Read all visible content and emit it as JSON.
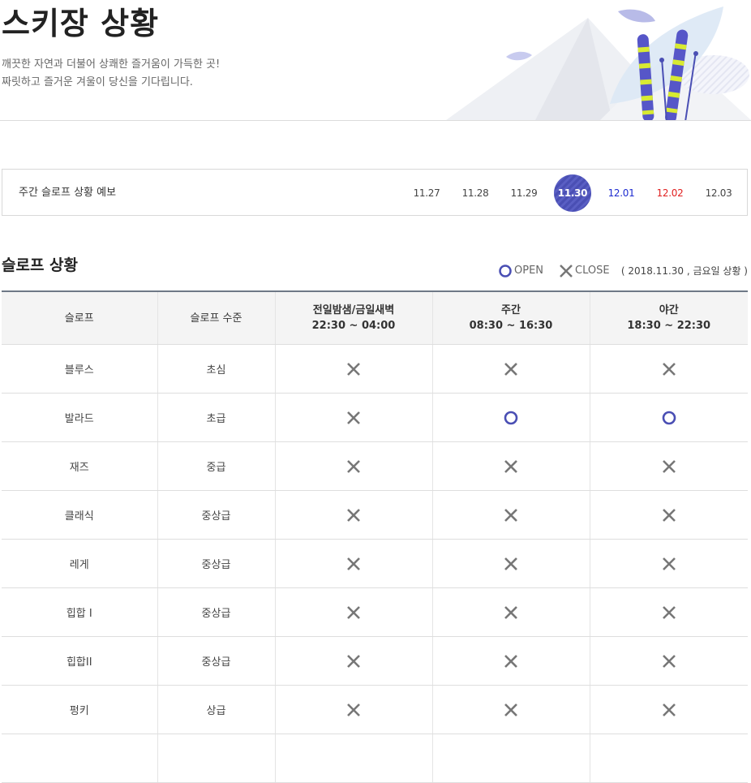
{
  "header": {
    "title": "스키장 상황",
    "subtitle_line1": "깨끗한 자연과 더불어 상쾌한 즐거움이 가득한 곳!",
    "subtitle_line2": "짜릿하고 즐거운 겨울이 당신을 기다립니다."
  },
  "forecast": {
    "label": "주간 슬로프 상황 예보",
    "dates": [
      {
        "label": "11.27",
        "state": "normal"
      },
      {
        "label": "11.28",
        "state": "normal"
      },
      {
        "label": "11.29",
        "state": "normal"
      },
      {
        "label": "11.30",
        "state": "active"
      },
      {
        "label": "12.01",
        "state": "saturday"
      },
      {
        "label": "12.02",
        "state": "sunday"
      },
      {
        "label": "12.03",
        "state": "normal"
      }
    ]
  },
  "status": {
    "title": "슬로프 상황",
    "legend_open": "OPEN",
    "legend_close": "CLOSE",
    "date_text": "( 2018.11.30 , 금요일 상황 )",
    "columns": {
      "slope": "슬로프",
      "level": "슬로프 수준",
      "overnight_title": "전일밤샘/금일새벽",
      "overnight_time": "22:30 ~ 04:00",
      "day_title": "주간",
      "day_time": "08:30 ~ 16:30",
      "night_title": "야간",
      "night_time": "18:30 ~ 22:30"
    },
    "rows": [
      {
        "name": "블루스",
        "level": "초심",
        "overnight": "close",
        "day": "close",
        "night": "close"
      },
      {
        "name": "발라드",
        "level": "초급",
        "overnight": "close",
        "day": "open",
        "night": "open"
      },
      {
        "name": "재즈",
        "level": "중급",
        "overnight": "close",
        "day": "close",
        "night": "close"
      },
      {
        "name": "클래식",
        "level": "중상급",
        "overnight": "close",
        "day": "close",
        "night": "close"
      },
      {
        "name": "레게",
        "level": "중상급",
        "overnight": "close",
        "day": "close",
        "night": "close"
      },
      {
        "name": "힙합 I",
        "level": "중상급",
        "overnight": "close",
        "day": "close",
        "night": "close"
      },
      {
        "name": "힙합II",
        "level": "중상급",
        "overnight": "close",
        "day": "close",
        "night": "close"
      },
      {
        "name": "펑키",
        "level": "상급",
        "overnight": "close",
        "day": "close",
        "night": "close"
      },
      {
        "name": "",
        "level": "",
        "overnight": "",
        "day": "",
        "night": ""
      }
    ]
  },
  "colors": {
    "open": "#4a4fb4",
    "close": "#777777",
    "saturday": "#1d2bd0",
    "sunday": "#e02020"
  }
}
